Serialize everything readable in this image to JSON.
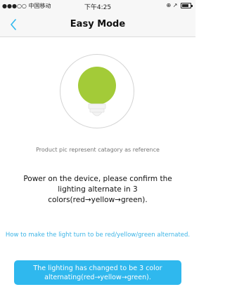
{
  "status_bar": {
    "carrier": "●●●○○ 中国移动",
    "time": "下午4:25",
    "right_icons": "⊕ ↗"
  },
  "nav": {
    "title": "Easy Mode",
    "back_icon": "chevron-left-icon"
  },
  "product": {
    "bulb_color": "#a3cb38",
    "caption": "Product pic represent catagory as reference"
  },
  "instruction": "Power on the device, please confirm the lighting alternate in 3 colors(red→yellow→green).",
  "help_link": "How to make the light turn to be red/yellow/green alternated.",
  "confirm_button": "The lighting has changed to be 3 color alternating(red→yellow→green).",
  "colors": {
    "accent": "#2fb8ee",
    "link": "#3cb4e6",
    "bulb": "#a3cb38"
  }
}
